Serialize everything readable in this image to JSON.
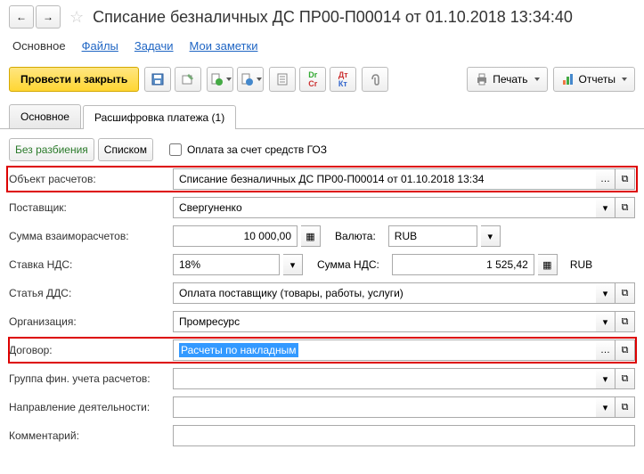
{
  "header": {
    "title": "Списание безналичных ДС ПР00-П00014 от 01.10.2018 13:34:40"
  },
  "links": {
    "main": "Основное",
    "files": "Файлы",
    "tasks": "Задачи",
    "notes": "Мои заметки"
  },
  "toolbar": {
    "submit": "Провести и закрыть",
    "print": "Печать",
    "reports": "Отчеты"
  },
  "tabs": {
    "main": "Основное",
    "detail": "Расшифровка платежа (1)"
  },
  "subbar": {
    "nobreak": "Без разбиения",
    "list": "Списком",
    "goz": "Оплата за счет средств ГОЗ"
  },
  "fields": {
    "object_label": "Объект расчетов:",
    "object_value": "Списание безналичных ДС ПР00-П00014 от 01.10.2018 13:34",
    "supplier_label": "Поставщик:",
    "supplier_value": "Свергуненко",
    "sum_label": "Сумма взаиморасчетов:",
    "sum_value": "10 000,00",
    "currency_label": "Валюта:",
    "currency_value": "RUB",
    "vat_rate_label": "Ставка НДС:",
    "vat_rate_value": "18%",
    "vat_sum_label": "Сумма НДС:",
    "vat_sum_value": "1 525,42",
    "vat_sum_unit": "RUB",
    "dds_label": "Статья ДДС:",
    "dds_value": "Оплата поставщику (товары, работы, услуги)",
    "org_label": "Организация:",
    "org_value": "Промресурс",
    "contract_label": "Договор:",
    "contract_value": "Расчеты по накладным",
    "fingroup_label": "Группа фин. учета расчетов:",
    "direction_label": "Направление деятельности:",
    "comment_label": "Комментарий:"
  }
}
